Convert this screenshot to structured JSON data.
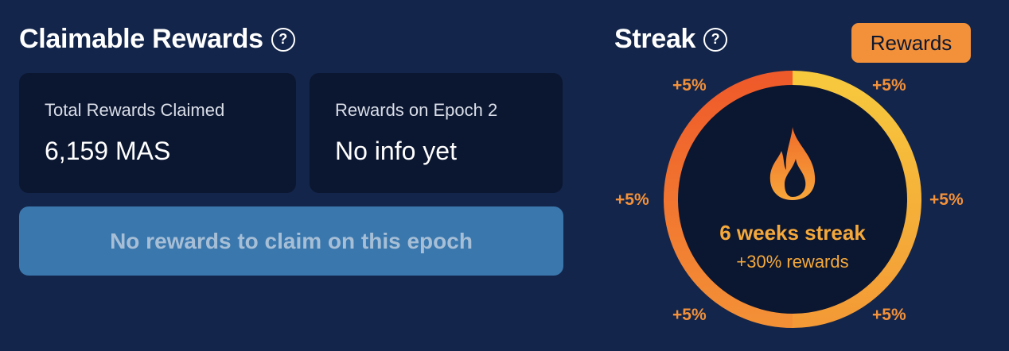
{
  "claimable": {
    "title": "Claimable Rewards",
    "help": "?",
    "cards": [
      {
        "label": "Total Rewards Claimed",
        "value": "6,159 MAS"
      },
      {
        "label": "Rewards on Epoch 2",
        "value": "No info yet"
      }
    ],
    "claim_button": "No rewards to claim on this epoch"
  },
  "streak": {
    "title": "Streak",
    "help": "?",
    "rewards_button": "Rewards",
    "bonuses": [
      "+5%",
      "+5%",
      "+5%",
      "+5%",
      "+5%",
      "+5%"
    ],
    "weeks_label": "6 weeks streak",
    "bonus_label": "+30% rewards",
    "icon": "flame-icon"
  },
  "colors": {
    "background": "#13254a",
    "card": "#0b1630",
    "claim_button": "#3a77ad",
    "accent": "#f3913a",
    "ring_start": "#ef5a2a",
    "ring_end": "#f7c23a"
  }
}
